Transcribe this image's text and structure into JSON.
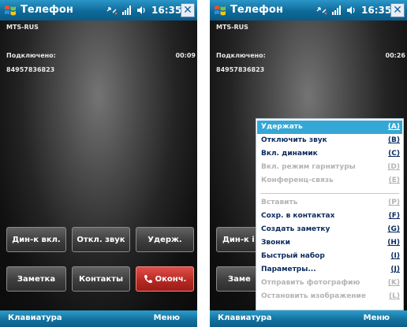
{
  "left_screen": {
    "window_title": "Телефон",
    "clock": "16:35",
    "close_label": "✕",
    "carrier": "MTS-RUS",
    "status_label": "Подключено:",
    "call_timer": "00:09",
    "phone_number": "84957836823",
    "buttons": {
      "speaker": "Дин-к вкл.",
      "mute": "Откл. звук",
      "hold": "Удерж.",
      "note": "Заметка",
      "contacts": "Контакты",
      "end_call": "Оконч."
    },
    "softkeys": {
      "left": "Клавиатура",
      "right": "Меню"
    }
  },
  "right_screen": {
    "window_title": "Телефон",
    "clock": "16:35",
    "close_label": "✕",
    "carrier": "MTS-RUS",
    "status_label": "Подключено:",
    "call_timer": "00:26",
    "phone_number": "84957836823",
    "buttons": {
      "speaker_partial": "Дин-к і",
      "note_partial": "Заме"
    },
    "softkeys": {
      "left": "Клавиатура",
      "right": "Меню"
    },
    "menu": {
      "items": [
        {
          "label": "Удержать",
          "key": "(A)",
          "state": "selected"
        },
        {
          "label": "Отключить звук",
          "key": "(B)",
          "state": "enabled"
        },
        {
          "label": "Вкл. динамик",
          "key": "(C)",
          "state": "enabled"
        },
        {
          "label": "Вкл. режим гарнитуры",
          "key": "(D)",
          "state": "disabled"
        },
        {
          "label": "Конференц-связь",
          "key": "(E)",
          "state": "disabled"
        },
        {
          "label": "Вставить",
          "key": "(P)",
          "state": "disabled"
        },
        {
          "label": "Сохр. в контактах",
          "key": "(F)",
          "state": "enabled"
        },
        {
          "label": "Создать заметку",
          "key": "(G)",
          "state": "enabled"
        },
        {
          "label": "Звонки",
          "key": "(H)",
          "state": "enabled"
        },
        {
          "label": "Быстрый набор",
          "key": "(I)",
          "state": "enabled"
        },
        {
          "label": "Параметры...",
          "key": "(J)",
          "state": "enabled"
        },
        {
          "label": "Отправить фотографию",
          "key": "(K)",
          "state": "disabled"
        },
        {
          "label": "Остановить изображение",
          "key": "(L)",
          "state": "disabled"
        }
      ]
    }
  },
  "colors": {
    "titlebar": "#0f6a9a",
    "menu_highlight": "#35a7d6",
    "end_call_red": "#b82a24",
    "menu_text": "#0a2a5e",
    "menu_disabled": "#b4b4b4"
  },
  "icons": [
    "windows-start-icon",
    "sync-icon",
    "signal-icon",
    "volume-icon",
    "close-icon",
    "phone-handset-icon"
  ]
}
